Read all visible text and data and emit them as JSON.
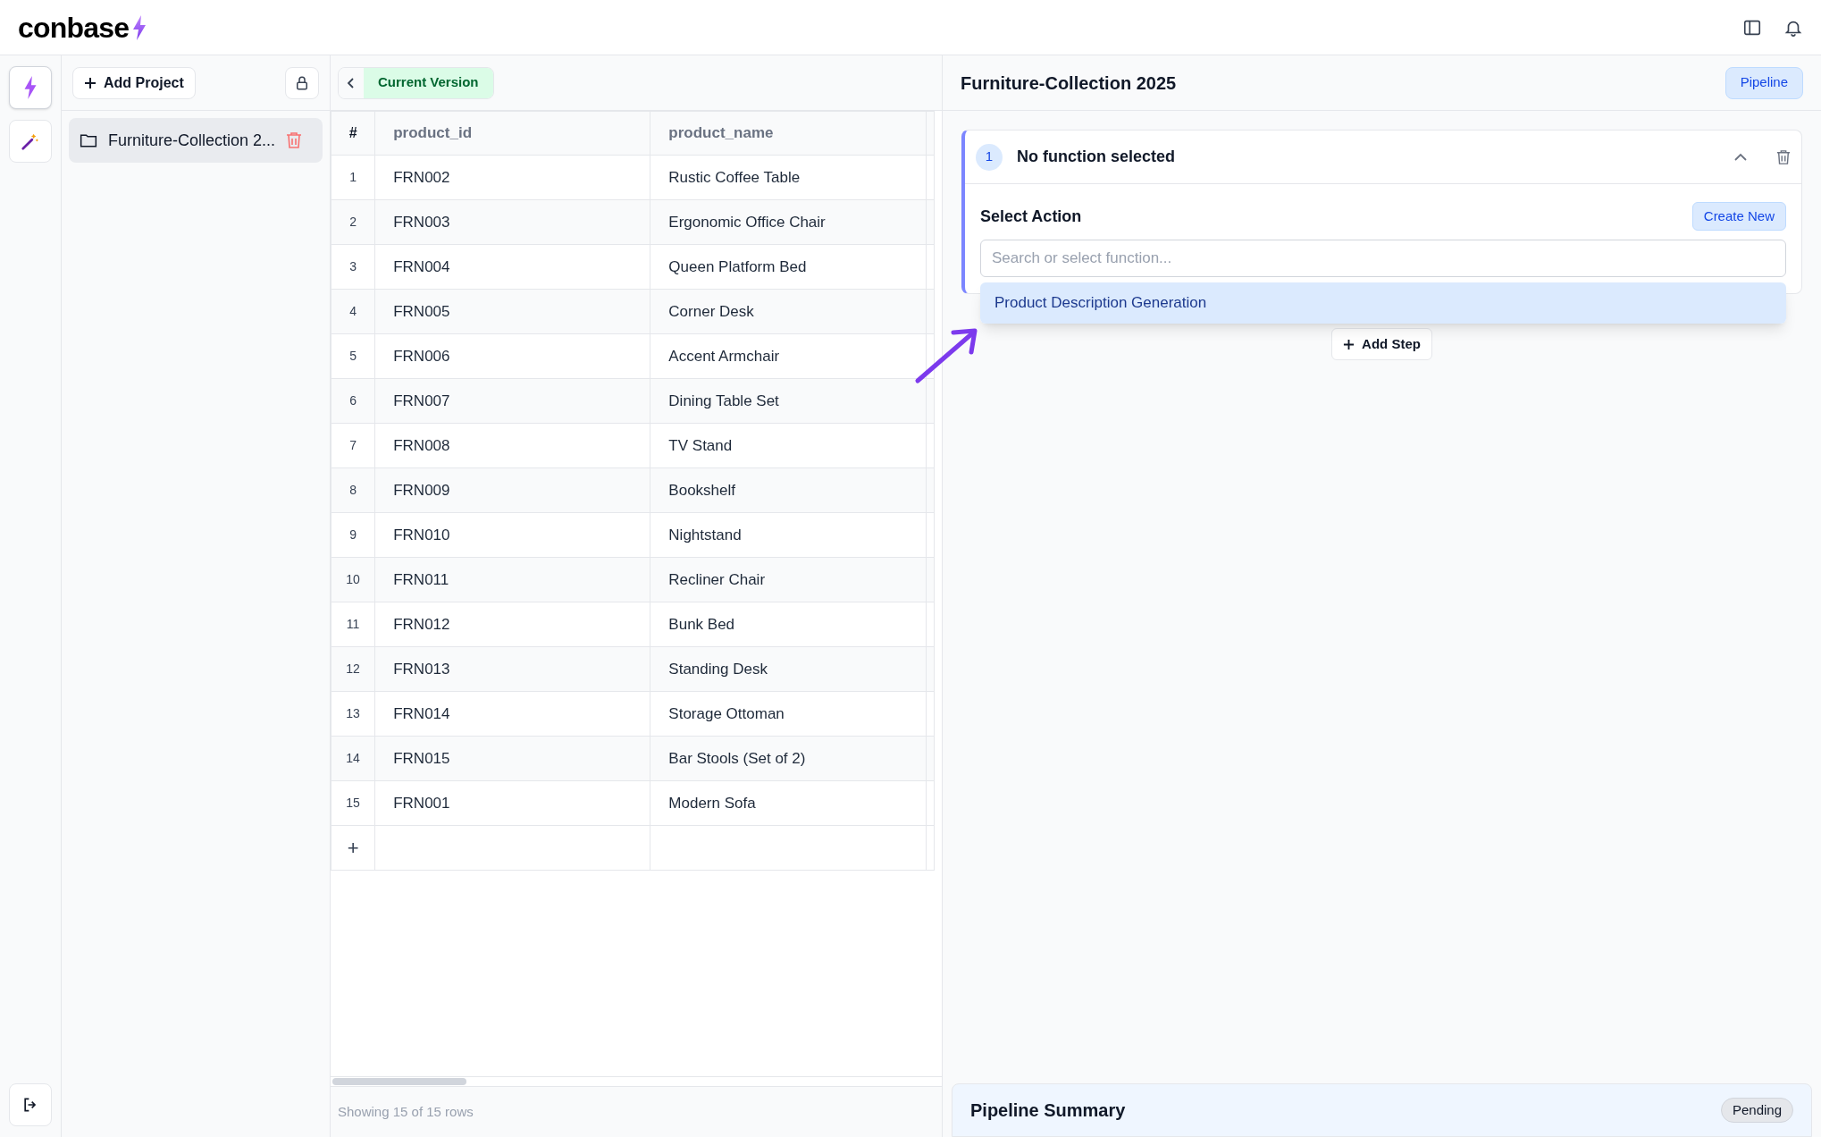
{
  "app": {
    "logo": "conbase"
  },
  "rail": [
    {
      "kind": "bolt",
      "selected": true
    },
    {
      "kind": "wand",
      "selected": false
    }
  ],
  "projects": {
    "add_label": "Add Project",
    "items": [
      {
        "name": "Furniture-Collection 2...",
        "selected": true
      }
    ]
  },
  "table": {
    "version_label": "Current Version",
    "columns": [
      "#",
      "product_id",
      "product_name"
    ],
    "rows": [
      [
        "1",
        "FRN002",
        "Rustic Coffee Table"
      ],
      [
        "2",
        "FRN003",
        "Ergonomic Office Chair"
      ],
      [
        "3",
        "FRN004",
        "Queen Platform Bed"
      ],
      [
        "4",
        "FRN005",
        "Corner Desk"
      ],
      [
        "5",
        "FRN006",
        "Accent Armchair"
      ],
      [
        "6",
        "FRN007",
        "Dining Table Set"
      ],
      [
        "7",
        "FRN008",
        "TV Stand"
      ],
      [
        "8",
        "FRN009",
        "Bookshelf"
      ],
      [
        "9",
        "FRN010",
        "Nightstand"
      ],
      [
        "10",
        "FRN011",
        "Recliner Chair"
      ],
      [
        "11",
        "FRN012",
        "Bunk Bed"
      ],
      [
        "12",
        "FRN013",
        "Standing Desk"
      ],
      [
        "13",
        "FRN014",
        "Storage Ottoman"
      ],
      [
        "14",
        "FRN015",
        "Bar Stools (Set of 2)"
      ],
      [
        "15",
        "FRN001",
        "Modern Sofa"
      ]
    ],
    "add_row": "+",
    "footer": "Showing 15 of 15 rows"
  },
  "pipeline": {
    "title": "Furniture-Collection 2025",
    "mode_button": "Pipeline",
    "steps": [
      {
        "number": "1",
        "title": "No function selected",
        "expanded": true,
        "label": "Select Action",
        "create_button": "Create New",
        "placeholder": "Search or select function...",
        "options": [
          "Product Description Generation"
        ]
      }
    ],
    "add_step": "Add Step",
    "summary_title": "Pipeline Summary",
    "summary_status": "Pending"
  }
}
